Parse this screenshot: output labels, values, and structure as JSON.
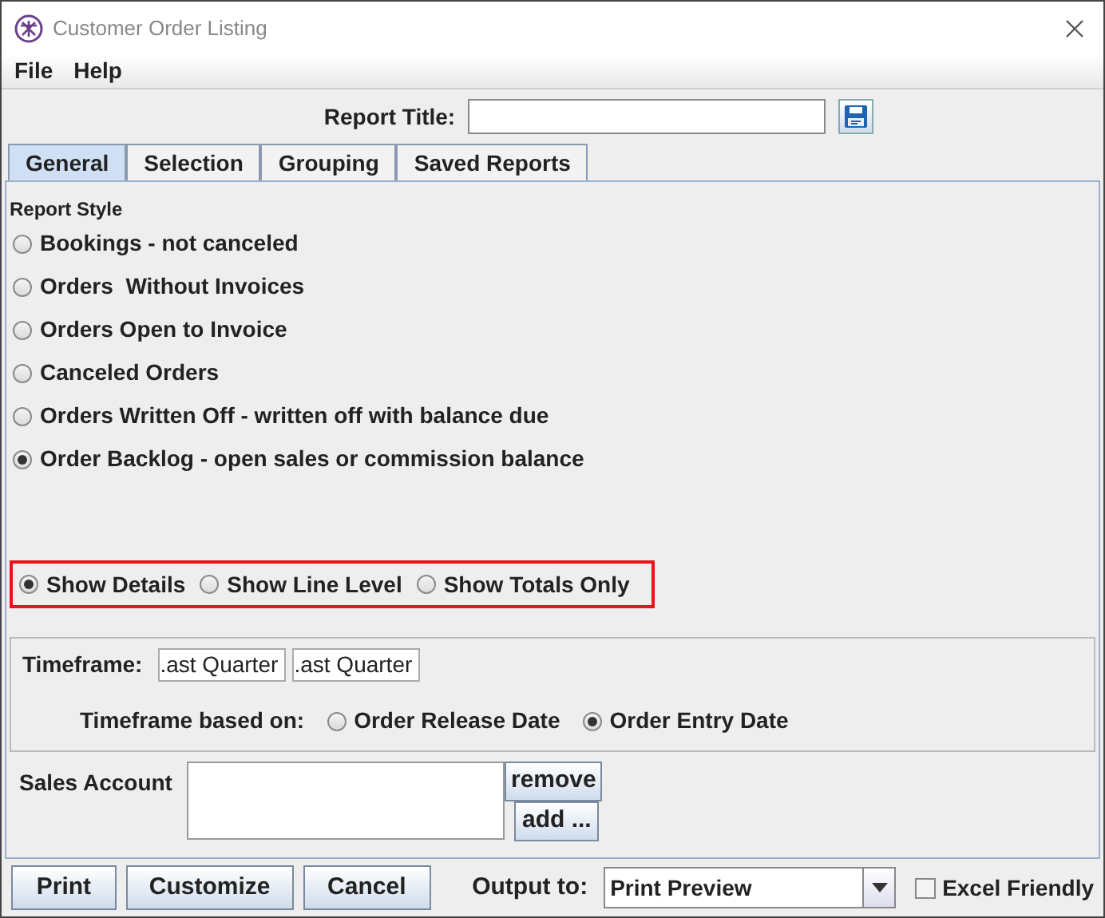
{
  "window": {
    "title": "Customer Order Listing"
  },
  "menu": [
    "File",
    "Help"
  ],
  "report_title": {
    "label": "Report Title:"
  },
  "tabs": [
    {
      "label": "General",
      "selected": true
    },
    {
      "label": "Selection",
      "selected": false
    },
    {
      "label": "Grouping",
      "selected": false
    },
    {
      "label": "Saved Reports",
      "selected": false
    }
  ],
  "report_style": {
    "heading": "Report Style",
    "options": [
      {
        "label": "Bookings - not canceled",
        "selected": false
      },
      {
        "label": "Orders  Without Invoices",
        "selected": false
      },
      {
        "label": "Orders Open to Invoice",
        "selected": false
      },
      {
        "label": "Canceled Orders",
        "selected": false
      },
      {
        "label": "Orders Written Off - written off with balance due",
        "selected": false
      },
      {
        "label": "Order Backlog - open sales or commission balance",
        "selected": true
      }
    ]
  },
  "detail_level": [
    {
      "label": "Show Details",
      "selected": true
    },
    {
      "label": "Show Line Level",
      "selected": false
    },
    {
      "label": "Show Totals Only",
      "selected": false
    }
  ],
  "timeframe": {
    "label": "Timeframe:",
    "from": ".ast Quarter",
    "to": ".ast Quarter",
    "based_on_label": "Timeframe based on:",
    "based_on": [
      {
        "label": "Order Release Date",
        "selected": false
      },
      {
        "label": "Order Entry Date",
        "selected": true
      }
    ]
  },
  "sales_account": {
    "label": "Sales Account",
    "remove": "remove",
    "add": "add ..."
  },
  "buttons": [
    "Print",
    "Customize",
    "Cancel"
  ],
  "output": {
    "label": "Output to:",
    "value": "Print Preview"
  },
  "excel_friendly": {
    "label": "Excel Friendly",
    "checked": false
  }
}
